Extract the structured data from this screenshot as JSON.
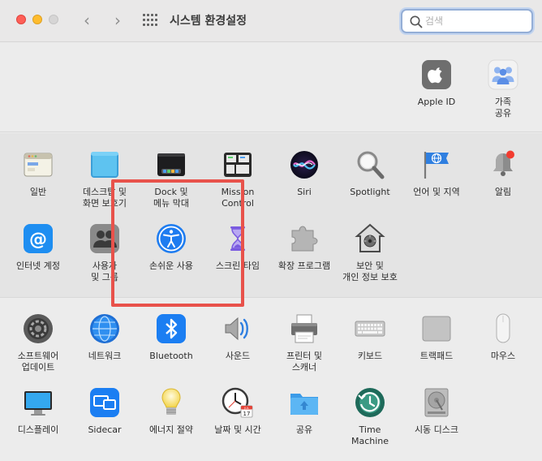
{
  "window": {
    "title": "시스템 환경설정",
    "search_placeholder": "검색",
    "back": "‹",
    "forward": "›"
  },
  "top": [
    {
      "label": "Apple ID",
      "icon": "apple-id-icon"
    },
    {
      "label": "가족\n공유",
      "icon": "family-sharing-icon"
    }
  ],
  "row1": [
    {
      "label": "일반",
      "icon": "general-icon"
    },
    {
      "label": "데스크탑 및\n화면 보호기",
      "icon": "desktop-screensaver-icon"
    },
    {
      "label": "Dock 및\n메뉴 막대",
      "icon": "dock-menubar-icon"
    },
    {
      "label": "Mission\nControl",
      "icon": "mission-control-icon"
    },
    {
      "label": "Siri",
      "icon": "siri-icon"
    },
    {
      "label": "Spotlight",
      "icon": "spotlight-icon"
    },
    {
      "label": "언어 및 지역",
      "icon": "language-region-icon"
    },
    {
      "label": "알림",
      "icon": "notifications-icon"
    }
  ],
  "row2": [
    {
      "label": "인터넷 계정",
      "icon": "internet-accounts-icon"
    },
    {
      "label": "사용자\n및 그룹",
      "icon": "users-groups-icon"
    },
    {
      "label": "손쉬운 사용",
      "icon": "accessibility-icon"
    },
    {
      "label": "스크린 타임",
      "icon": "screen-time-icon"
    },
    {
      "label": "확장 프로그램",
      "icon": "extensions-icon"
    },
    {
      "label": "보안 및\n개인 정보 보호",
      "icon": "security-privacy-icon"
    }
  ],
  "row3": [
    {
      "label": "소프트웨어\n업데이트",
      "icon": "software-update-icon"
    },
    {
      "label": "네트워크",
      "icon": "network-icon"
    },
    {
      "label": "Bluetooth",
      "icon": "bluetooth-icon"
    },
    {
      "label": "사운드",
      "icon": "sound-icon"
    },
    {
      "label": "프린터 및\n스캐너",
      "icon": "printers-scanners-icon"
    },
    {
      "label": "키보드",
      "icon": "keyboard-icon"
    },
    {
      "label": "트랙패드",
      "icon": "trackpad-icon"
    },
    {
      "label": "마우스",
      "icon": "mouse-icon"
    }
  ],
  "row4": [
    {
      "label": "디스플레이",
      "icon": "displays-icon"
    },
    {
      "label": "Sidecar",
      "icon": "sidecar-icon"
    },
    {
      "label": "에너지 절약",
      "icon": "energy-saver-icon"
    },
    {
      "label": "날짜 및 시간",
      "icon": "date-time-icon"
    },
    {
      "label": "공유",
      "icon": "sharing-icon"
    },
    {
      "label": "Time\nMachine",
      "icon": "time-machine-icon"
    },
    {
      "label": "시동 디스크",
      "icon": "startup-disk-icon"
    }
  ],
  "calendar": {
    "month": "JUL",
    "day": "17"
  },
  "colors": {
    "highlight": "#e8524b",
    "search_focus": "#94aed6"
  }
}
